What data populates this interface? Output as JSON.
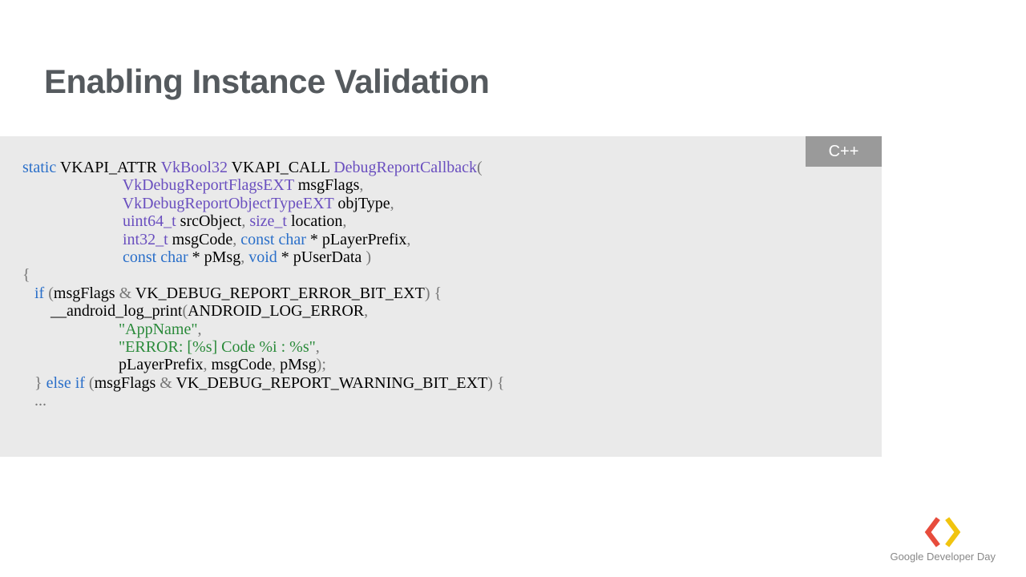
{
  "title": "Enabling Instance Validation",
  "lang_badge": "C++",
  "code": {
    "l1_static": "static",
    "l1_attr": " VKAPI_ATTR ",
    "l1_vkbool": "VkBool32",
    "l1_call": " VKAPI_CALL ",
    "l1_fn": "DebugReportCallback",
    "l1_op": "(",
    "l2_type": "VkDebugReportFlagsEXT",
    "l2_rest": " msgFlags",
    "l2_c": ",",
    "l3_type": "VkDebugReportObjectTypeEXT",
    "l3_rest": " objType",
    "l3_c": ",",
    "l4_t1": "uint64_t",
    "l4_r1": " srcObject",
    "l4_c1": ", ",
    "l4_t2": "size_t",
    "l4_r2": " location",
    "l4_c2": ",",
    "l5_t1": "int32_t",
    "l5_r1": " msgCode",
    "l5_c1": ", ",
    "l5_kw": "const char",
    "l5_r2": " * pLayerPrefix",
    "l5_c2": ",",
    "l6_kw": "const char",
    "l6_r1": " * pMsg",
    "l6_c1": ", ",
    "l6_kw2": "void",
    "l6_r2": " * pUserData ",
    "l6_cp": ")",
    "l7_ob": "{",
    "l8_if": "if",
    "l8_op": " (",
    "l8_r1": "msgFlags ",
    "l8_amp": "&",
    "l8_r2": " VK_DEBUG_REPORT_ERROR_BIT_EXT",
    "l8_cp": ") {",
    "l9_fn": "__android_log_print",
    "l9_op": "(",
    "l9_r1": "ANDROID_LOG_ERROR",
    "l9_c": ",",
    "l10_s": "\"AppName\"",
    "l10_c": ",",
    "l11_s": "\"ERROR: [%s] Code %i : %s\"",
    "l11_c": ",",
    "l12_r1": "pLayerPrefix",
    "l12_c1": ", ",
    "l12_r2": "msgCode",
    "l12_c2": ", ",
    "l12_r3": "pMsg",
    "l12_cp": ");",
    "l13_cb": "} ",
    "l13_else": "else if",
    "l13_op": " (",
    "l13_r1": "msgFlags ",
    "l13_amp": "&",
    "l13_r2": " VK_DEBUG_REPORT_WARNING_BIT_EXT",
    "l13_cp": ") {",
    "l14_dots": "..."
  },
  "footer": "Google Developer Day"
}
